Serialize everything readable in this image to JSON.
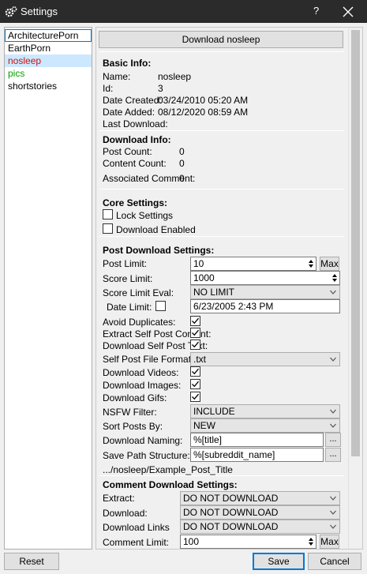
{
  "window": {
    "title": "Settings",
    "help": "?"
  },
  "subreddits": [
    {
      "name": "ArchitecturePorn",
      "color": "#000000"
    },
    {
      "name": "EarthPorn",
      "color": "#000000"
    },
    {
      "name": "nosleep",
      "color": "#d01010"
    },
    {
      "name": "pics",
      "color": "#00a000"
    },
    {
      "name": "shortstories",
      "color": "#000000"
    }
  ],
  "download_button": "Download nosleep",
  "basic": {
    "header": "Basic Info:",
    "name_label": "Name:",
    "name_value": "nosleep",
    "id_label": "Id:",
    "id_value": "3",
    "created_label": "Date Created:",
    "created_value": "03/24/2010 05:20 AM",
    "added_label": "Date Added:",
    "added_value": "08/12/2020 08:59 AM",
    "last_label": "Last Download:"
  },
  "download_info": {
    "header": "Download Info:",
    "post_count_label": "Post Count:",
    "post_count": "0",
    "content_count_label": "Content Count:",
    "content_count": "0",
    "assoc_label": "Associated Comment:",
    "assoc_value": "0"
  },
  "core": {
    "header": "Core Settings:",
    "lock_label": "Lock Settings",
    "lock_checked": false,
    "enabled_label": "Download Enabled",
    "enabled_checked": false
  },
  "post": {
    "header": "Post Download Settings:",
    "post_limit_label": "Post Limit:",
    "post_limit": "10",
    "max_label": "Max",
    "score_limit_label": "Score Limit:",
    "score_limit": "1000",
    "score_eval_label": "Score Limit Eval:",
    "score_eval": "NO LIMIT",
    "date_limit_label": "Date Limit:",
    "date_limit_checked": false,
    "date_limit": "6/23/2005 2:43 PM",
    "avoid_dup_label": "Avoid Duplicates:",
    "extract_self_label": "Extract Self Post Content:",
    "download_self_label": "Download Self Post Text:",
    "self_format_label": "Self Post File Format:",
    "self_format": ".txt",
    "videos_label": "Download Videos:",
    "images_label": "Download Images:",
    "gifs_label": "Download Gifs:",
    "nsfw_label": "NSFW Filter:",
    "nsfw": "INCLUDE",
    "sort_label": "Sort Posts By:",
    "sort": "NEW",
    "naming_label": "Download Naming:",
    "naming": "%[title]",
    "save_path_label": "Save Path Structure:",
    "save_path": "%[subreddit_name]",
    "example_path": ".../nosleep/Example_Post_Title",
    "browse_label": "..."
  },
  "comment": {
    "header": "Comment Download Settings:",
    "extract_label": "Extract:",
    "extract": "DO NOT DOWNLOAD",
    "download_label": "Download:",
    "download": "DO NOT DOWNLOAD",
    "links_label": "Download Links",
    "links": "DO NOT DOWNLOAD",
    "limit_label": "Comment Limit:",
    "limit": "100",
    "max_label": "Max"
  },
  "footer": {
    "reset": "Reset",
    "save": "Save",
    "cancel": "Cancel"
  }
}
